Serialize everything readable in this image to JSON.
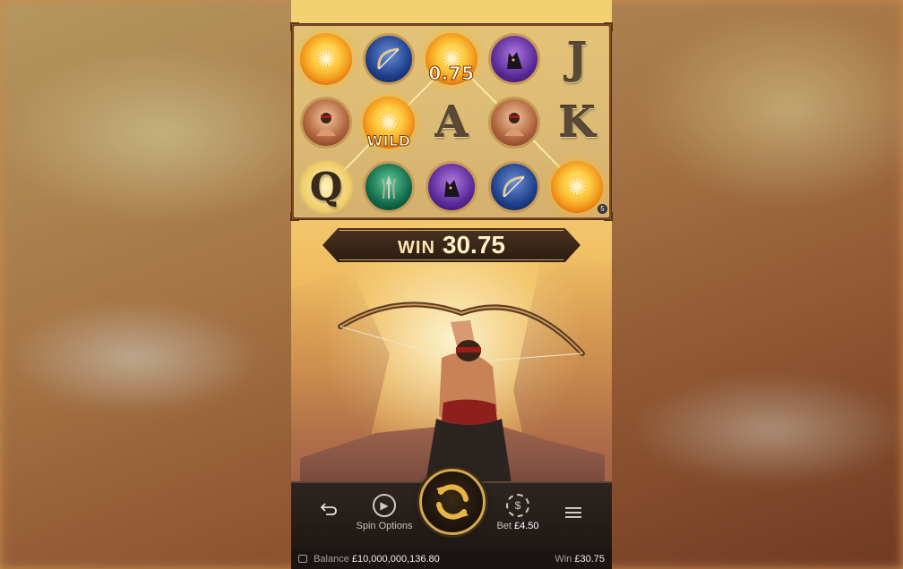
{
  "reels": {
    "multiplier": "0.75",
    "wild_label": "WILD",
    "letters": {
      "j": "J",
      "a": "A",
      "k": "K",
      "q": "Q"
    },
    "scatter_badge": "5"
  },
  "win_banner": {
    "label": "WIN",
    "amount": "30.75"
  },
  "controls": {
    "spin_options_label": "Spin Options",
    "bet_label": "Bet",
    "bet_value": "£4.50"
  },
  "info_bar": {
    "balance_label": "Balance",
    "balance_value": "£10,000,000,136.80",
    "win_label": "Win",
    "win_value": "£30.75"
  },
  "colors": {
    "frame": "#7b4a2a",
    "gold": "#d6a84d",
    "bar_bg": "#1e1815"
  }
}
